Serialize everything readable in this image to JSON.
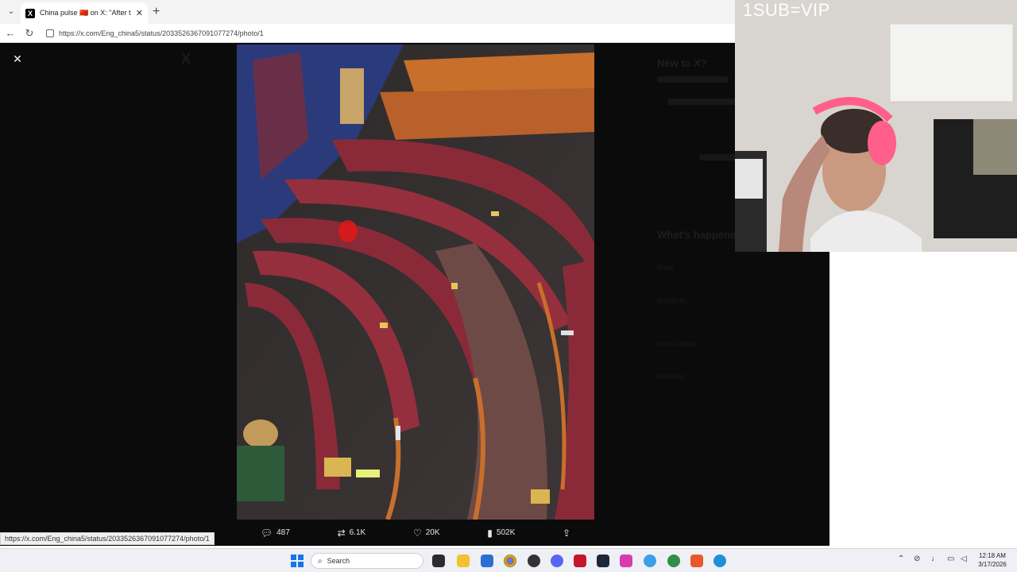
{
  "browser": {
    "tab_title": "China pulse 🇨🇳 on X: \"After the pa",
    "url": "https://x.com/Eng_china5/status/2033526367091077274/photo/1",
    "status_url": "https://x.com/Eng_china5/status/2033526367091077274/photo/1"
  },
  "x_viewer": {
    "close_label": "✕",
    "actions": {
      "replies": "487",
      "reposts": "6.1K",
      "likes": "20K",
      "views": "502K"
    }
  },
  "sidebar": {
    "new_to_x": "New to X?",
    "whats_happening": "What's happening",
    "trends": [
      "Nate",
      "Rockets",
      "Ima Udoka",
      "#AdFire"
    ]
  },
  "webcam": {
    "overlay_text": "1SUB=VIP"
  },
  "taskbar": {
    "search_placeholder": "Search",
    "time": "12:18 AM",
    "date": "3/17/2026"
  },
  "colors": {
    "x_background": "#0b0b0b",
    "seat_red": "#8a2a38",
    "seat_wood": "#c86f2c"
  }
}
